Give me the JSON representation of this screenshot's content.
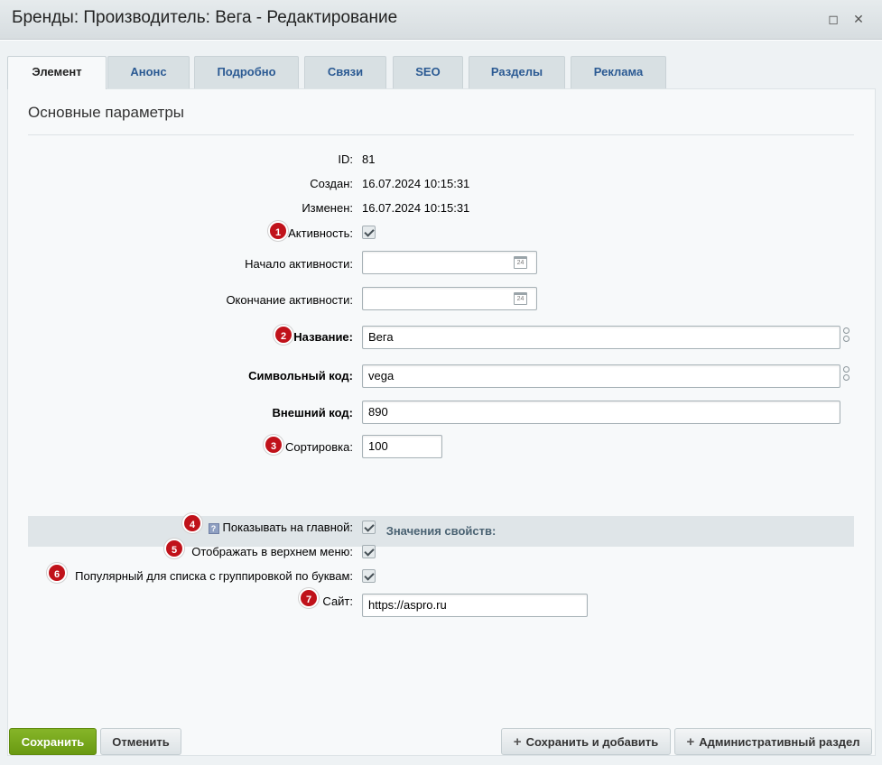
{
  "window": {
    "title": "Бренды: Производитель: Вега - Редактирование",
    "maximize_glyph": "◻",
    "close_glyph": "✕"
  },
  "tabs": [
    {
      "label": "Элемент",
      "active": true
    },
    {
      "label": "Анонс"
    },
    {
      "label": "Подробно"
    },
    {
      "label": "Связи"
    },
    {
      "label": "SEO"
    },
    {
      "label": "Разделы"
    },
    {
      "label": "Реклама"
    }
  ],
  "section_title": "Основные параметры",
  "fields": {
    "id": {
      "label": "ID:",
      "value": "81"
    },
    "created": {
      "label": "Создан:",
      "value": "16.07.2024 10:15:31"
    },
    "modified": {
      "label": "Изменен:",
      "value": "16.07.2024 10:15:31"
    },
    "active": {
      "label": "Активность:",
      "checked": true,
      "badge": "1"
    },
    "active_from": {
      "label": "Начало активности:",
      "value": "",
      "calendar_day": "24"
    },
    "active_to": {
      "label": "Окончание активности:",
      "value": "",
      "calendar_day": "24"
    },
    "name": {
      "label": "Название:",
      "value": "Вега",
      "badge": "2"
    },
    "code": {
      "label": "Символьный код:",
      "value": "vega"
    },
    "external_code": {
      "label": "Внешний код:",
      "value": "890"
    },
    "sort": {
      "label": "Сортировка:",
      "value": "100",
      "badge": "3"
    }
  },
  "properties": {
    "title": "Значения свойств:",
    "show_on_main": {
      "label": "Показывать на главной:",
      "hint": "?",
      "checked": true,
      "badge": "4"
    },
    "show_in_top_menu": {
      "label": "Отображать в верхнем меню:",
      "checked": true,
      "badge": "5"
    },
    "popular_alpha": {
      "label": "Популярный для списка с группировкой по буквам:",
      "checked": true,
      "badge": "6"
    },
    "site": {
      "label": "Сайт:",
      "value": "https://aspro.ru",
      "badge": "7"
    }
  },
  "buttons": {
    "save": "Сохранить",
    "cancel": "Отменить",
    "save_add": "Сохранить и добавить",
    "admin_section": "Административный раздел",
    "plus": "+"
  },
  "colors": {
    "badge": "#c0121a",
    "save_button": "#7aa81d",
    "tab_text": "#2b5a93"
  }
}
